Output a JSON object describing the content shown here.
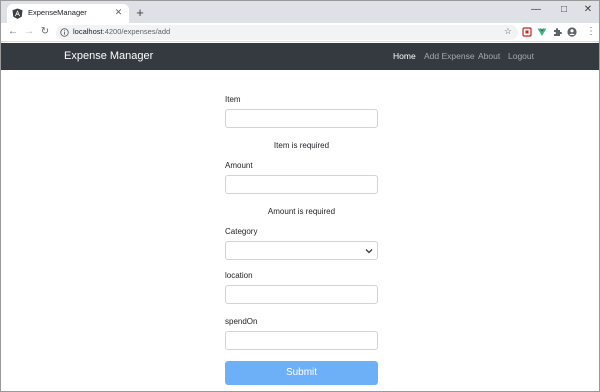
{
  "browser": {
    "tab_title": "ExpenseManager",
    "url_host": "localhost",
    "url_path": ":4200/expenses/add",
    "minimize_glyph": "—",
    "maximize_glyph": "□",
    "close_glyph": "✕"
  },
  "navbar": {
    "brand": "Expense Manager",
    "links": [
      "Home",
      "Add Expense",
      "About",
      "Logout"
    ]
  },
  "form": {
    "item_label": "Item",
    "item_value": "",
    "item_error": "Item is required",
    "amount_label": "Amount",
    "amount_value": "",
    "amount_error": "Amount is required",
    "category_label": "Category",
    "category_value": "",
    "location_label": "location",
    "location_value": "",
    "spendon_label": "spendOn",
    "spendon_value": "",
    "submit_label": "Submit"
  },
  "colors": {
    "navbar_bg": "#343a40",
    "submit_bg": "#6eb0f7",
    "tabstrip_bg": "#dee1e6"
  }
}
